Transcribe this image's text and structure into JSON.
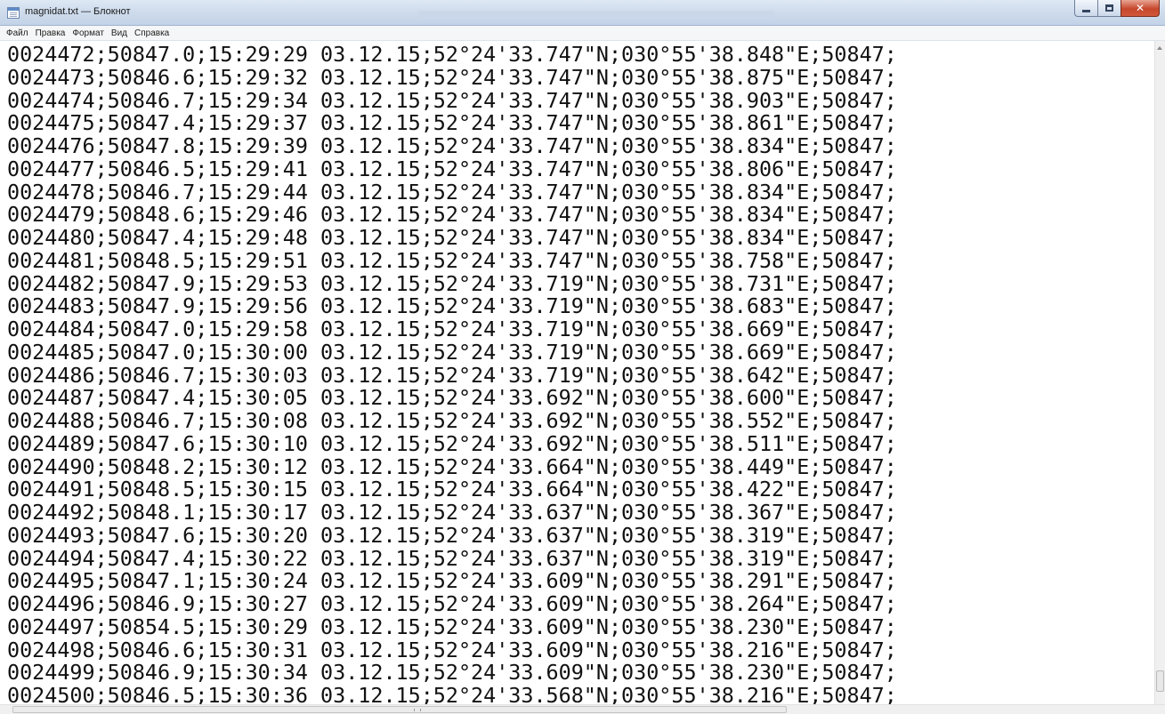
{
  "window": {
    "title": "magnidat.txt — Блокнот",
    "controls": {
      "minimize_icon": "minimize-icon",
      "maximize_icon": "maximize-icon",
      "close_glyph": "✕"
    }
  },
  "menu": {
    "items": [
      "Файл",
      "Правка",
      "Формат",
      "Вид",
      "Справка"
    ]
  },
  "document": {
    "lines": [
      "0024472;50847.0;15:29:29 03.12.15;52°24'33.747\"N;030°55'38.848\"E;50847;",
      "0024473;50846.6;15:29:32 03.12.15;52°24'33.747\"N;030°55'38.875\"E;50847;",
      "0024474;50846.7;15:29:34 03.12.15;52°24'33.747\"N;030°55'38.903\"E;50847;",
      "0024475;50847.4;15:29:37 03.12.15;52°24'33.747\"N;030°55'38.861\"E;50847;",
      "0024476;50847.8;15:29:39 03.12.15;52°24'33.747\"N;030°55'38.834\"E;50847;",
      "0024477;50846.5;15:29:41 03.12.15;52°24'33.747\"N;030°55'38.806\"E;50847;",
      "0024478;50846.7;15:29:44 03.12.15;52°24'33.747\"N;030°55'38.834\"E;50847;",
      "0024479;50848.6;15:29:46 03.12.15;52°24'33.747\"N;030°55'38.834\"E;50847;",
      "0024480;50847.4;15:29:48 03.12.15;52°24'33.747\"N;030°55'38.834\"E;50847;",
      "0024481;50848.5;15:29:51 03.12.15;52°24'33.747\"N;030°55'38.758\"E;50847;",
      "0024482;50847.9;15:29:53 03.12.15;52°24'33.719\"N;030°55'38.731\"E;50847;",
      "0024483;50847.9;15:29:56 03.12.15;52°24'33.719\"N;030°55'38.683\"E;50847;",
      "0024484;50847.0;15:29:58 03.12.15;52°24'33.719\"N;030°55'38.669\"E;50847;",
      "0024485;50847.0;15:30:00 03.12.15;52°24'33.719\"N;030°55'38.669\"E;50847;",
      "0024486;50846.7;15:30:03 03.12.15;52°24'33.719\"N;030°55'38.642\"E;50847;",
      "0024487;50847.4;15:30:05 03.12.15;52°24'33.692\"N;030°55'38.600\"E;50847;",
      "0024488;50846.7;15:30:08 03.12.15;52°24'33.692\"N;030°55'38.552\"E;50847;",
      "0024489;50847.6;15:30:10 03.12.15;52°24'33.692\"N;030°55'38.511\"E;50847;",
      "0024490;50848.2;15:30:12 03.12.15;52°24'33.664\"N;030°55'38.449\"E;50847;",
      "0024491;50848.5;15:30:15 03.12.15;52°24'33.664\"N;030°55'38.422\"E;50847;",
      "0024492;50848.1;15:30:17 03.12.15;52°24'33.637\"N;030°55'38.367\"E;50847;",
      "0024493;50847.6;15:30:20 03.12.15;52°24'33.637\"N;030°55'38.319\"E;50847;",
      "0024494;50847.4;15:30:22 03.12.15;52°24'33.637\"N;030°55'38.319\"E;50847;",
      "0024495;50847.1;15:30:24 03.12.15;52°24'33.609\"N;030°55'38.291\"E;50847;",
      "0024496;50846.9;15:30:27 03.12.15;52°24'33.609\"N;030°55'38.264\"E;50847;",
      "0024497;50854.5;15:30:29 03.12.15;52°24'33.609\"N;030°55'38.230\"E;50847;",
      "0024498;50846.6;15:30:31 03.12.15;52°24'33.609\"N;030°55'38.216\"E;50847;",
      "0024499;50846.9;15:30:34 03.12.15;52°24'33.609\"N;030°55'38.230\"E;50847;",
      "0024500;50846.5;15:30:36 03.12.15;52°24'33.568\"N;030°55'38.216\"E;50847;"
    ]
  }
}
